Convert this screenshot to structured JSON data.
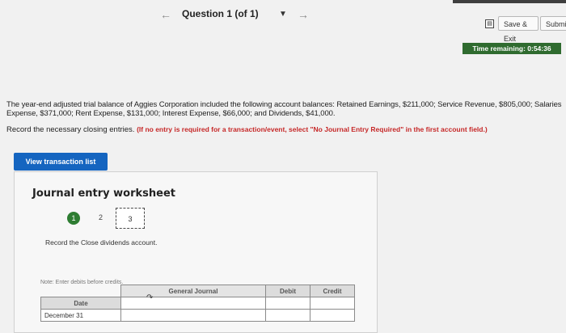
{
  "nav": {
    "question_title": "Question 1 (of 1)",
    "save_exit_label": "Save & Exit",
    "submit_label": "Submit",
    "time_remaining": "Time remaining: 0:54:36"
  },
  "prompt": {
    "text": "The year-end adjusted trial balance of Aggies Corporation included the following account balances: Retained Earnings, $211,000; Service Revenue, $805,000; Salaries Expense, $371,000; Rent Expense, $131,000; Interest Expense, $66,000; and Dividends, $41,000.",
    "instruction": "Record the necessary closing entries.",
    "instruction_note": "(If no entry is required for a transaction/event, select \"No Journal Entry Required\" in the first account field.)"
  },
  "view_transactions_label": "View transaction list",
  "worksheet": {
    "title": "Journal entry worksheet",
    "steps": [
      "1",
      "2",
      "3"
    ],
    "task": "Record the Close dividends account.",
    "note": "Note: Enter debits before credits.",
    "table": {
      "headers": {
        "date": "Date",
        "journal": "General Journal",
        "debit": "Debit",
        "credit": "Credit"
      },
      "rows": [
        {
          "date": "December 31",
          "journal": "",
          "debit": "",
          "credit": ""
        }
      ]
    }
  },
  "icons": [
    "save-icon",
    "dropdown-icon",
    "prev-arrow-icon",
    "next-arrow-icon",
    "cursor-icon"
  ],
  "colors": {
    "primary_button": "#1565c0",
    "timer_bg": "#2f6b2f",
    "step_done": "#2e7d32",
    "instruction_red": "#c62828"
  }
}
